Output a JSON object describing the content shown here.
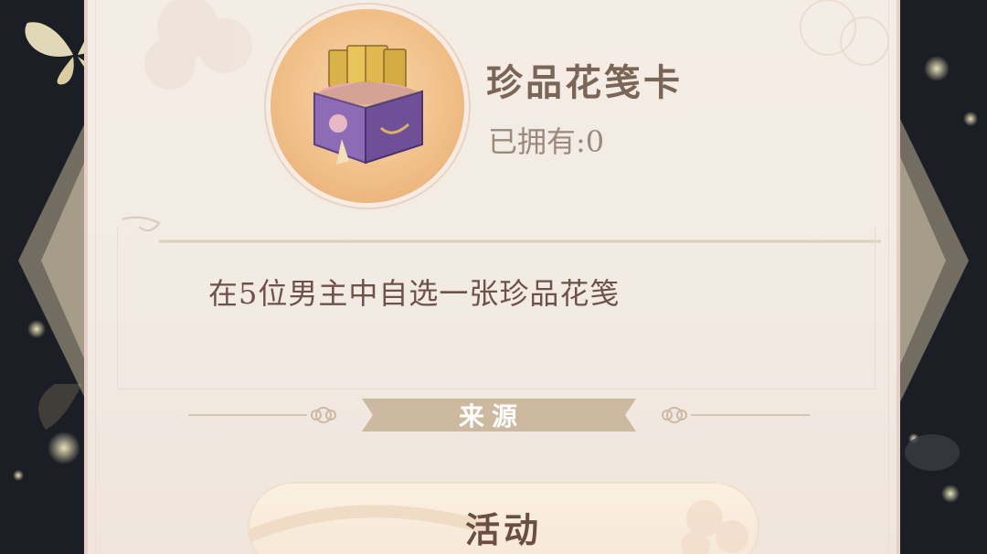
{
  "item": {
    "name": "珍品花笺卡",
    "owned_label": "已拥有:0",
    "icon": "treasure-box-card-icon"
  },
  "description": "在5位男主中自选一张珍品花笺",
  "source": {
    "label": "来源"
  },
  "buttons": {
    "activity_label": "活动"
  },
  "colors": {
    "panel_bg": "#f4ede6",
    "title_text": "#7a6556",
    "desc_text": "#6e5248",
    "source_banner": "#cdb9a0",
    "circle_gold": "#f1c08a"
  }
}
